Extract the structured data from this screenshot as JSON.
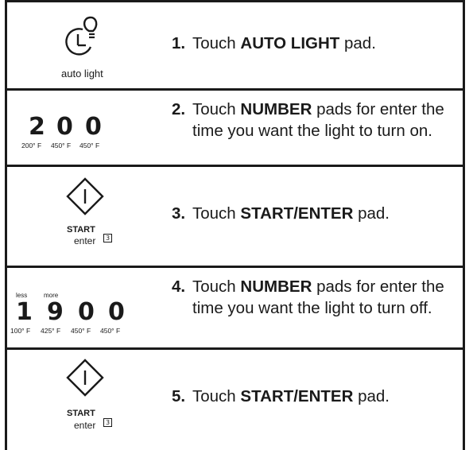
{
  "steps": [
    {
      "number": "1.",
      "text_before": "Touch ",
      "bold": "AUTO LIGHT",
      "text_after": " pad.",
      "icon": "auto-light-icon",
      "icon_caption": "auto light"
    },
    {
      "number": "2.",
      "text_before": "Touch ",
      "bold": "NUMBER",
      "text_after": " pads for enter the time you want the light to turn on.",
      "icon": "number-pads-icon",
      "pads": [
        {
          "digit": "2",
          "temp": "200° F"
        },
        {
          "digit": "0",
          "temp": "450° F"
        },
        {
          "digit": "0",
          "temp": "450° F"
        }
      ]
    },
    {
      "number": "3.",
      "text_before": "Touch ",
      "bold": "START/ENTER",
      "text_after": " pad.",
      "icon": "start-enter-icon",
      "start_label": "START",
      "enter_label": "enter",
      "key_number": "3"
    },
    {
      "number": "4.",
      "text_before": "Touch ",
      "bold": "NUMBER",
      "text_after": " pads for enter the time you want the light to turn off.",
      "icon": "number-pads-icon",
      "less_label": "less",
      "more_label": "more",
      "pads": [
        {
          "digit": "1",
          "temp": "100° F"
        },
        {
          "digit": "9",
          "temp": "425° F"
        },
        {
          "digit": "0",
          "temp": "450° F"
        },
        {
          "digit": "0",
          "temp": "450° F"
        }
      ]
    },
    {
      "number": "5.",
      "text_before": "Touch ",
      "bold": "START/ENTER",
      "text_after": " pad.",
      "icon": "start-enter-icon",
      "start_label": "START",
      "enter_label": "enter",
      "key_number": "3"
    }
  ]
}
